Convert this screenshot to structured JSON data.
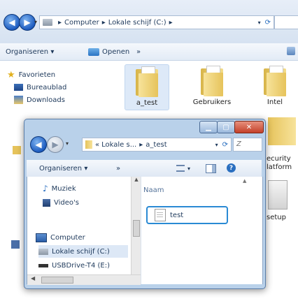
{
  "back_window": {
    "breadcrumb": [
      "Computer",
      "Lokale schijf (C:)"
    ],
    "toolbar": {
      "organize": "Organiseren ▾",
      "open": "Openen",
      "more": "»"
    },
    "nav": {
      "favorites": "Favorieten",
      "desktop": "Bureaublad",
      "downloads": "Downloads"
    },
    "items": [
      "a_test",
      "Gebruikers",
      "Intel"
    ],
    "right_labels": [
      "ecurity",
      "latform",
      "setup"
    ]
  },
  "front_window": {
    "breadcrumb_prefix": "«",
    "breadcrumb": [
      "Lokale s...",
      "a_test"
    ],
    "toolbar": {
      "organize": "Organiseren ▾",
      "more": "»"
    },
    "nav": {
      "music": "Muziek",
      "videos": "Video's",
      "computer": "Computer",
      "local_disk": "Lokale schijf (C:)",
      "usb": "USBDrive-T4 (E:)"
    },
    "column_header": "Naam",
    "files": [
      {
        "name": "test"
      }
    ],
    "search_placeholder": "Z",
    "highlight_color": "#2a8ad4"
  }
}
